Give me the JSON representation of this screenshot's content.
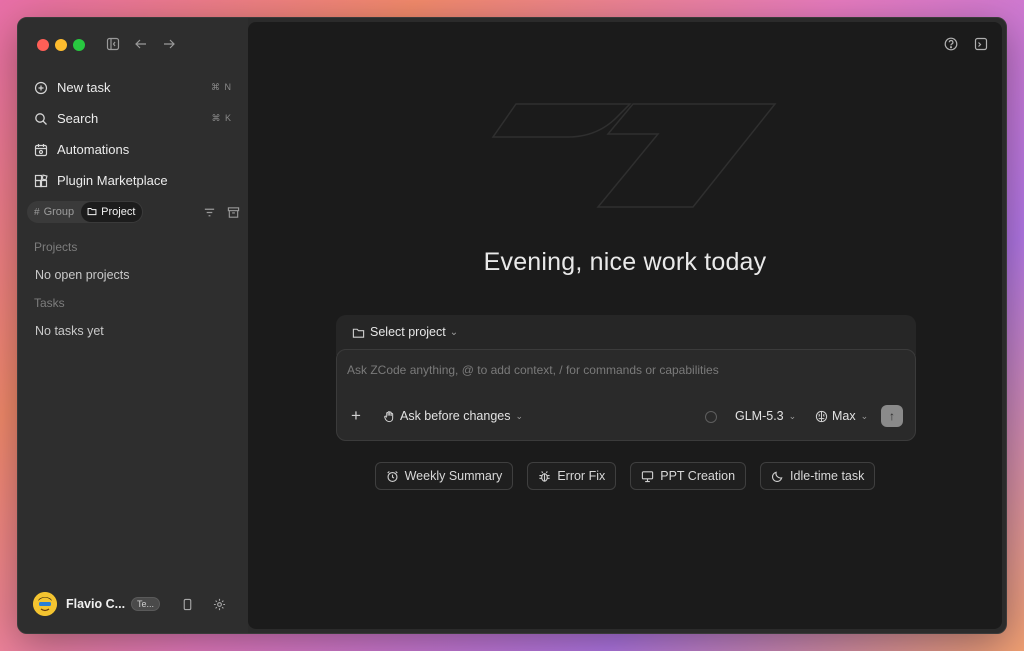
{
  "sidebar": {
    "nav": [
      {
        "label": "New task",
        "shortcut": "⌘ N",
        "icon": "new-task-icon"
      },
      {
        "label": "Search",
        "shortcut": "⌘ K",
        "icon": "search-icon"
      },
      {
        "label": "Automations",
        "icon": "automations-icon"
      },
      {
        "label": "Plugin Marketplace",
        "icon": "plugin-icon"
      }
    ],
    "filters": {
      "group_label": "Group",
      "project_label": "Project",
      "active": "Project"
    },
    "projects_heading": "Projects",
    "projects_empty": "No open projects",
    "tasks_heading": "Tasks",
    "tasks_empty": "No tasks yet",
    "user": {
      "name": "Flavio C...",
      "badge": "Te..."
    }
  },
  "main": {
    "greeting": "Evening, nice work today",
    "composer": {
      "select_project": "Select project",
      "placeholder": "Ask ZCode anything, @ to add context, / for commands or capabilities",
      "mode": "Ask before changes",
      "model": "GLM-5.3",
      "effort": "Max"
    },
    "suggestions": [
      {
        "label": "Weekly Summary",
        "icon": "alarm-clock-icon"
      },
      {
        "label": "Error Fix",
        "icon": "bug-icon"
      },
      {
        "label": "PPT Creation",
        "icon": "presentation-icon"
      },
      {
        "label": "Idle-time task",
        "icon": "moon-icon"
      }
    ]
  }
}
